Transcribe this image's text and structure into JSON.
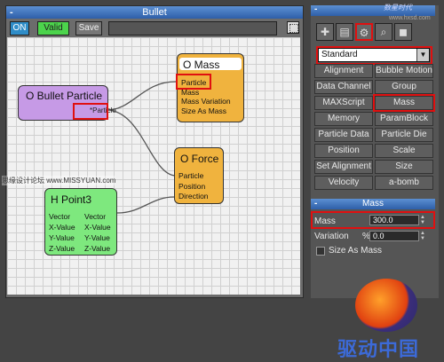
{
  "editor": {
    "title": "Bullet",
    "toolbar": {
      "on_label": "ON",
      "valid_label": "Valid",
      "save_label": "Save"
    },
    "nodes": {
      "bullet": {
        "title": "O Bullet Particle",
        "tag": "*Particle"
      },
      "mass": {
        "title": "O Mass",
        "lines": [
          "Particle",
          "Mass",
          "Mass Variation",
          "Size As Mass"
        ]
      },
      "force": {
        "title": "O Force",
        "lines": [
          "Particle",
          "Position",
          "Direction"
        ]
      },
      "point": {
        "title": "H Point3",
        "col_a": [
          "Vector",
          "X-Value",
          "Y-Value",
          "Z-Value"
        ],
        "col_b": [
          "Vector",
          "X-Value",
          "Y-Value",
          "Z-Value"
        ]
      }
    }
  },
  "panel": {
    "logo": "数星时代",
    "site": "www.hxsd.com",
    "dropdown_value": "Standard",
    "buttons": [
      "Alignment",
      "Bubble Motion",
      "Data Channel",
      "Group",
      "MAXScript",
      "Mass",
      "Memory",
      "ParamBlock",
      "Particle Data",
      "Particle Die",
      "Position",
      "Scale",
      "Set Alignment",
      "Size",
      "Velocity",
      "a-bomb"
    ],
    "section_title": "Mass",
    "mass_label": "Mass",
    "mass_value": "300.0",
    "variation_label": "Variation",
    "variation_unit": "%",
    "variation_value": "0.0",
    "size_as_mass_label": "Size As Mass"
  },
  "watermark_left": "思缘设计论坛 www.MISSYUAN.com",
  "watermark_brand": "驱动中国"
}
